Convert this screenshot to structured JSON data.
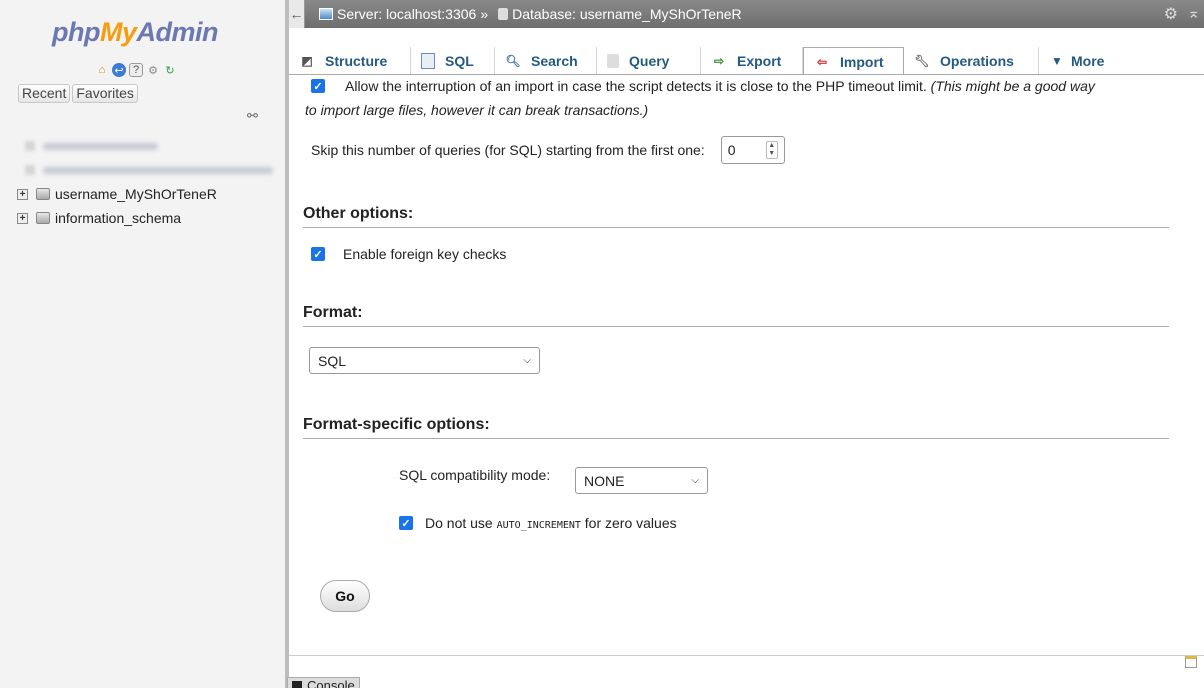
{
  "nav": {
    "logo_part1": "php",
    "logo_part2": "My",
    "logo_part3": "Admin",
    "recent_label": "Recent",
    "favorites_label": "Favorites",
    "databases": [
      {
        "name": "username_MyShOrTeneR"
      },
      {
        "name": "information_schema"
      }
    ]
  },
  "breadcrumb": {
    "server": "Server: localhost:3306",
    "separator": "»",
    "database": "Database: username_MyShOrTeneR"
  },
  "tabs": [
    {
      "label": "Structure",
      "icon": "structure-icon"
    },
    {
      "label": "SQL",
      "icon": "sql-icon"
    },
    {
      "label": "Search",
      "icon": "search-icon"
    },
    {
      "label": "Query",
      "icon": "query-icon"
    },
    {
      "label": "Export",
      "icon": "export-icon"
    },
    {
      "label": "Import",
      "icon": "import-icon",
      "active": true
    },
    {
      "label": "Operations",
      "icon": "wrench-icon"
    },
    {
      "label": "More",
      "icon": "triangle-down-icon"
    }
  ],
  "import": {
    "allow_interrupt_text": "Allow the interruption of an import in case the script detects it is close to the PHP timeout limit.",
    "allow_interrupt_hint_1": "(This might be a good way",
    "allow_interrupt_hint_2": "to import large files, however it can break transactions.)",
    "allow_interrupt_checked": true,
    "skip_label": "Skip this number of queries (for SQL) starting from the first one:",
    "skip_value": "0",
    "other_options_heading": "Other options:",
    "foreign_key_label": "Enable foreign key checks",
    "foreign_key_checked": true,
    "format_heading": "Format:",
    "format_value": "SQL",
    "format_specific_heading": "Format-specific options:",
    "compat_label": "SQL compatibility mode:",
    "compat_value": "NONE",
    "autoinc_prefix": "Do not use",
    "autoinc_code": "AUTO_INCREMENT",
    "autoinc_suffix": "for zero values",
    "autoinc_checked": true,
    "go_label": "Go"
  },
  "console": {
    "label": "Console"
  },
  "colors": {
    "accent_blue": "#1a73e8",
    "tab_text": "#235a81",
    "logo_blue": "#6c78af",
    "logo_orange": "#f89c0e"
  }
}
